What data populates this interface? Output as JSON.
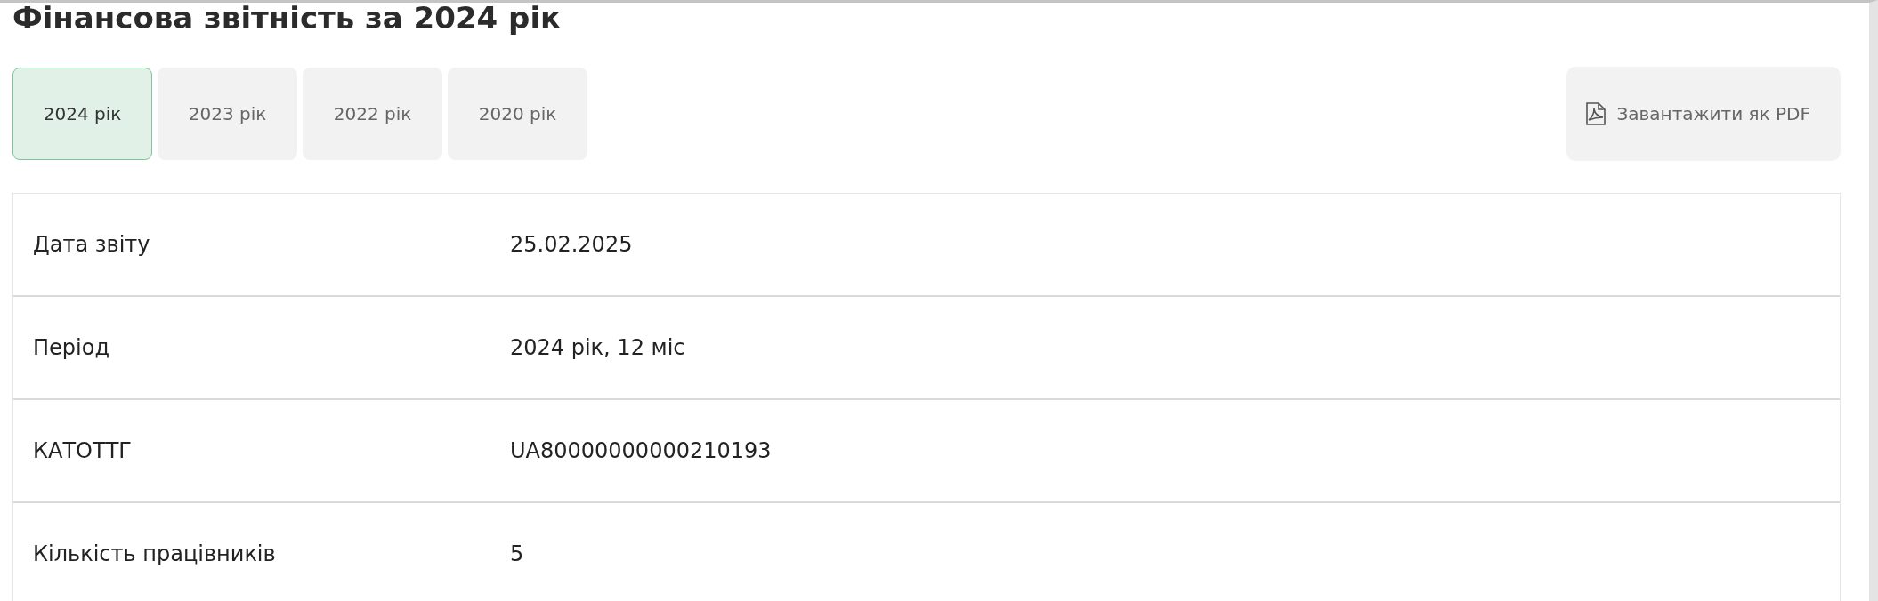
{
  "title": "Фінансова звітність за 2024 рік",
  "tabs": [
    {
      "label": "2024 рік",
      "selected": true
    },
    {
      "label": "2023 рік",
      "selected": false
    },
    {
      "label": "2022 рік",
      "selected": false
    },
    {
      "label": "2020 рік",
      "selected": false
    }
  ],
  "download_button": {
    "label": "Завантажити як PDF"
  },
  "table": {
    "rows": [
      {
        "label": "Дата звіту",
        "value": "25.02.2025"
      },
      {
        "label": "Період",
        "value": "2024 рік, 12 міс"
      },
      {
        "label": "КАТОТТГ",
        "value": "UA80000000000210193"
      },
      {
        "label": "Кількість працівників",
        "value": "5"
      }
    ]
  }
}
